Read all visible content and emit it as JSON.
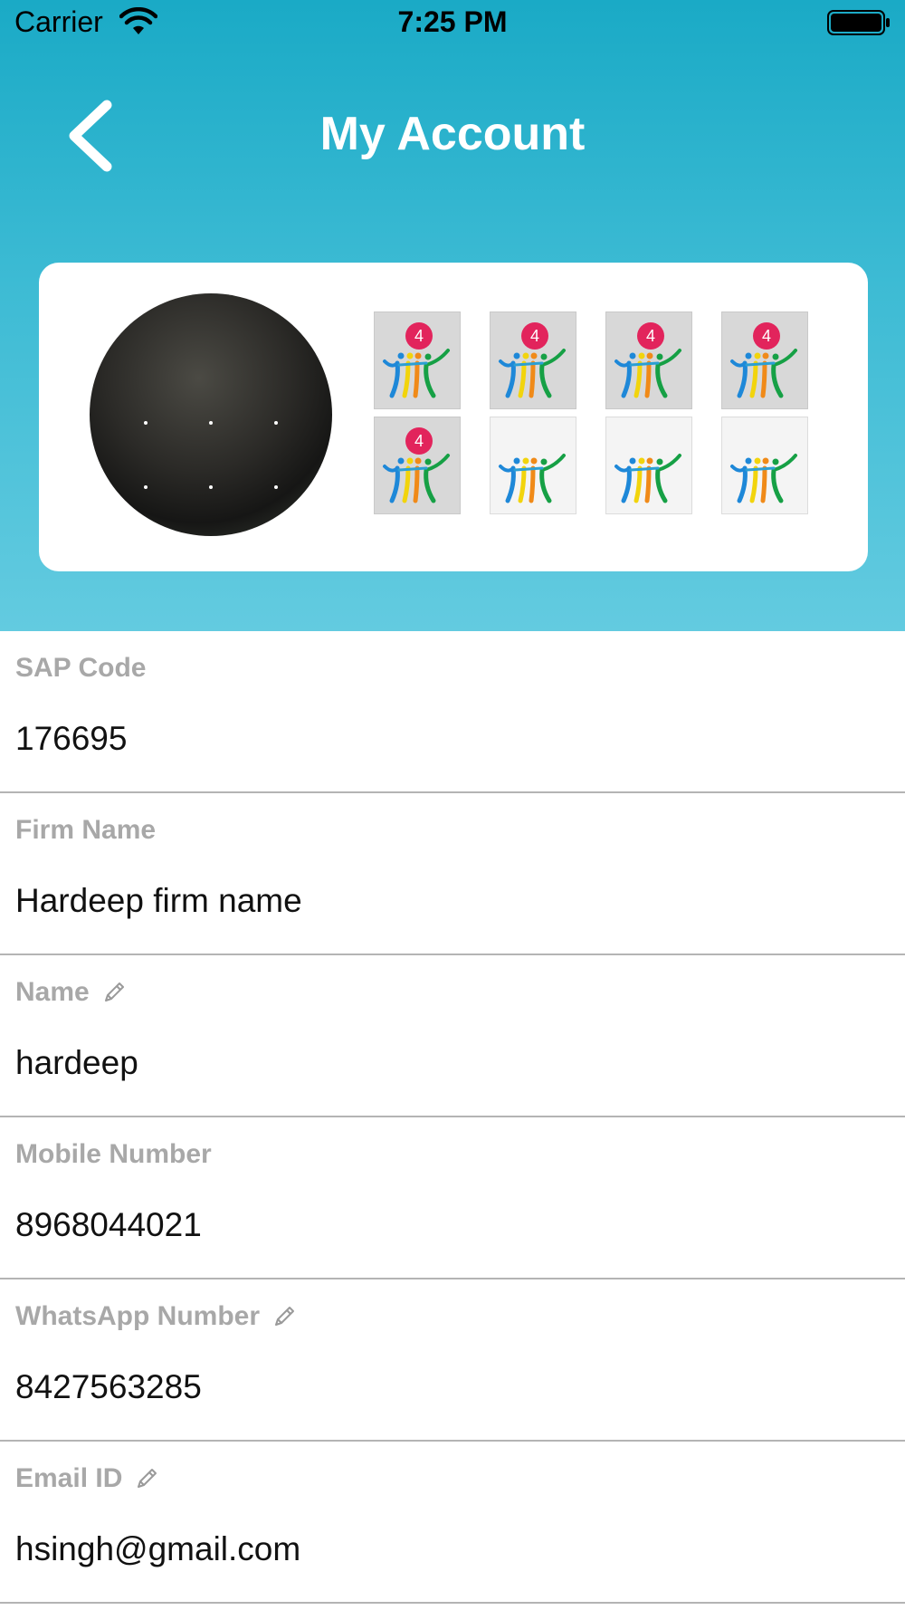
{
  "status_bar": {
    "carrier": "Carrier",
    "time": "7:25 PM"
  },
  "nav": {
    "title": "My Account",
    "back_icon": "chevron-left-icon"
  },
  "profile": {
    "avatar_icon": "user-photo",
    "badges": [
      {
        "count": "4",
        "earned": true
      },
      {
        "count": "4",
        "earned": true
      },
      {
        "count": "4",
        "earned": true
      },
      {
        "count": "4",
        "earned": true
      },
      {
        "count": "4",
        "earned": true
      },
      {
        "count": "",
        "earned": false
      },
      {
        "count": "",
        "earned": false
      },
      {
        "count": "",
        "earned": false
      }
    ]
  },
  "fields": [
    {
      "label": "SAP Code",
      "value": "176695",
      "editable": false
    },
    {
      "label": "Firm Name",
      "value": "Hardeep firm name",
      "editable": false
    },
    {
      "label": "Name",
      "value": "hardeep",
      "editable": true
    },
    {
      "label": "Mobile Number",
      "value": "8968044021",
      "editable": false
    },
    {
      "label": "WhatsApp Number",
      "value": "8427563285",
      "editable": true
    },
    {
      "label": "Email ID",
      "value": "hsingh@gmail.com",
      "editable": true
    }
  ],
  "colors": {
    "header_top": "#1aaac6",
    "header_bottom": "#63cbe0",
    "badge_count": "#e2245c",
    "label": "#a8a8a8",
    "divider": "#b4b4b4"
  }
}
